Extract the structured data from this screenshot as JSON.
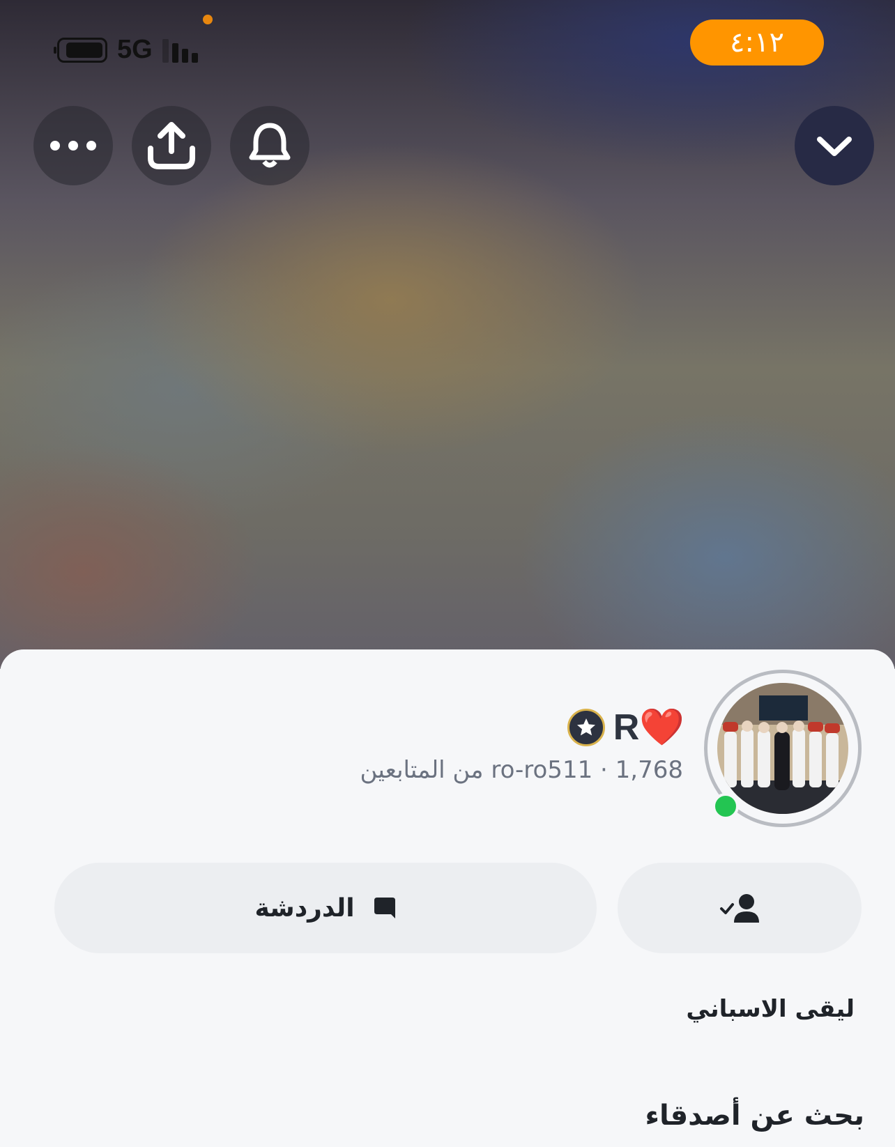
{
  "status_bar": {
    "network": "5G",
    "time": "٤:١٢",
    "time_pill_color": "#ff9500"
  },
  "top_actions": {
    "more_icon": "ellipsis-icon",
    "share_icon": "share-upload-icon",
    "notifications_icon": "bell-icon",
    "collapse_icon": "chevron-down-icon"
  },
  "profile": {
    "display_name": "R❤️",
    "badge_icon": "star-badge-icon",
    "username": "ro-ro511",
    "separator": "·",
    "followers_count": "1,768",
    "followers_label": "من المتابعين",
    "online": true,
    "online_color": "#23c552"
  },
  "actions": {
    "chat_label": "الدردشة",
    "chat_icon": "chat-bubble-icon",
    "friend_icon": "friend-added-icon"
  },
  "bio": "ليقى الاسباني",
  "friends_section": {
    "title": "بحث عن أصدقاء"
  }
}
